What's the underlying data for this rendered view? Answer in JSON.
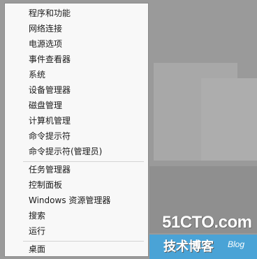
{
  "menu": {
    "items": [
      {
        "label": "程序和功能"
      },
      {
        "label": "网络连接"
      },
      {
        "label": "电源选项"
      },
      {
        "label": "事件查看器"
      },
      {
        "label": "系统"
      },
      {
        "label": "设备管理器"
      },
      {
        "label": "磁盘管理"
      },
      {
        "label": "计算机管理"
      },
      {
        "label": "命令提示符"
      },
      {
        "label": "命令提示符(管理员)"
      },
      {
        "label": "任务管理器"
      },
      {
        "label": "控制面板"
      },
      {
        "label": "Windows 资源管理器"
      },
      {
        "label": "搜索"
      },
      {
        "label": "运行"
      },
      {
        "label": "桌面"
      }
    ]
  },
  "watermark": {
    "main": "51CTO.com",
    "sub": "技术博客",
    "blog": "Blog"
  },
  "colors": {
    "background": "#9a9a9a",
    "menu_bg": "#f8f8f8",
    "accent": "#4aa3d6"
  }
}
